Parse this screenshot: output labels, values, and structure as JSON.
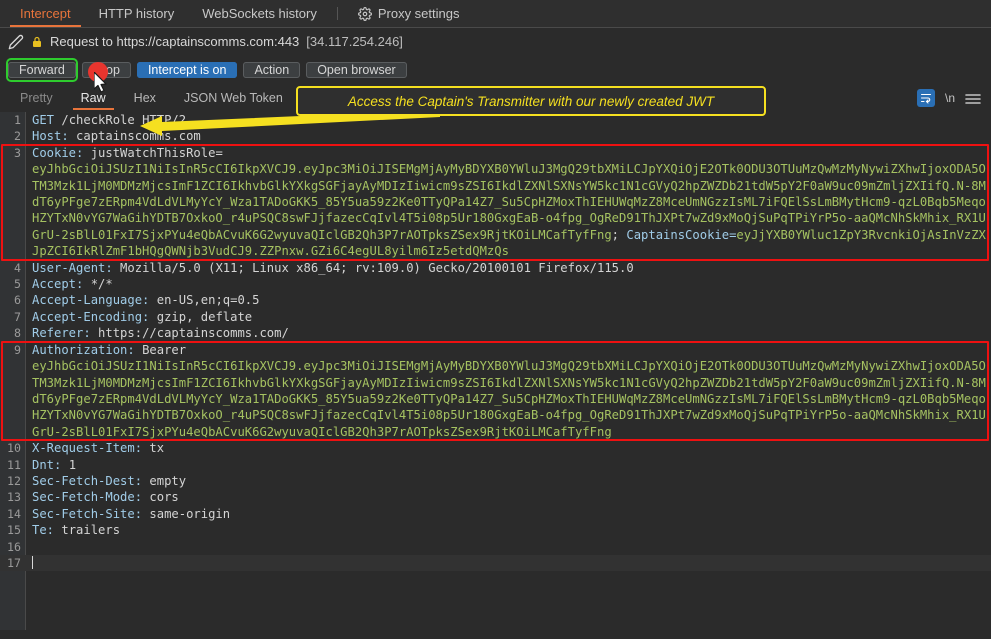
{
  "window": {
    "top_tabs": [
      {
        "label": "Intercept",
        "active": true
      },
      {
        "label": "HTTP history",
        "active": false
      },
      {
        "label": "WebSockets history",
        "active": false
      },
      {
        "label": "Proxy settings",
        "active": false,
        "icon": "gear-icon"
      }
    ]
  },
  "urlbar": {
    "pencil_icon": "pencil-icon",
    "lock_icon": "lock-icon",
    "text": "Request to https://captainscomms.com:443",
    "ip": "[34.117.254.246]"
  },
  "buttons": [
    {
      "label": "Forward",
      "style": "default",
      "focused": true
    },
    {
      "label": "Drop",
      "style": "default",
      "focused": false
    },
    {
      "label": "Intercept is on",
      "style": "primary",
      "focused": false
    },
    {
      "label": "Action",
      "style": "default",
      "focused": false
    },
    {
      "label": "Open browser",
      "style": "default",
      "focused": false
    }
  ],
  "editor_tabs": [
    {
      "label": "Pretty",
      "state": "dim"
    },
    {
      "label": "Raw",
      "state": "active"
    },
    {
      "label": "Hex",
      "state": "normal"
    },
    {
      "label": "JSON Web Token",
      "state": "normal"
    }
  ],
  "editor_tools": {
    "wrap_icon": "word-wrap-icon",
    "newline_label": "\\n",
    "menu_icon": "hamburger-menu-icon"
  },
  "annotation": {
    "text": "Access the Captain's Transmitter with our newly created JWT",
    "border_color": "#f5e020",
    "text_color": "#f5e020",
    "arrow_color": "#f5e020"
  },
  "highlight_color": "#ee1111",
  "request": {
    "lines": [
      {
        "num": "1",
        "kind": "request-line",
        "method": "GET",
        "path": " /checkRole",
        "rest": " HTTP/2"
      },
      {
        "num": "2",
        "kind": "header",
        "name": "Host:",
        "value": " captainscomms.com"
      },
      {
        "num": "3",
        "kind": "header-jwt",
        "name": "Cookie:",
        "value": " justWatchThisRole=",
        "jwt": "eyJhbGciOiJSUzI1NiIsInR5cCI6IkpXVCJ9.eyJpc3MiOiJISEMgMjAyMyBDYXB0YWluJ3MgQ29tbXMiLCJpYXQiOjE2OTk0ODU3OTUuMzQwMzMyNywiZXhwIjoxODA5OTM3Mzk1LjM0MDMzMjcsImF1ZCI6IkhvbGlkYXkgSGFjayAyMDIzIiwicm9sZSI6IkdlZXNlSXNsYW5kc1N1cGVyQ2hpZWZDb21tdW5pY2F0aW9uc09mZmljZXIifQ.N-8MdT6yPFge7zERpm4VdLdVLMyYcY_Wza1TADoGKK5_85Y5ua59z2Ke0TTyQPa14Z7_Su5CpHZMoxThIEHUWqMzZ8MceUmNGzzIsML7iFQElSsLmBMytHcm9-qzL0Bqb5MeqoHZYTxN0vYG7WaGihYDTB7OxkoO_r4uPSQC8swFJjfazecCqIvl4T5i08p5Ur180GxgEaB-o4fpg_OgReD91ThJXPt7wZd9xMoQjSuPqTPiYrP5o-aaQMcNhSkMhix_RX1UGrU-2sBlL01FxI7SjxPYu4eQbACvuK6G2wyuvaQIclGB2Qh3P7rAOTpksZSex9RjtKOiLMCafTyfFng",
        "trailing": "; ",
        "trailing_name": "CaptainsCookie=",
        "trailing_jwt": "eyJjYXB0YWluc1ZpY3RvcnkiOjAsInVzZXJpZCI6IkRlZmF1bHQgQWNjb3VudCJ9.ZZPnxw.GZi6C4egUL8yilm6Iz5etdQMzQs"
      },
      {
        "num": "4",
        "kind": "header",
        "name": "User-Agent:",
        "value": " Mozilla/5.0 (X11; Linux x86_64; rv:109.0) Gecko/20100101 Firefox/115.0"
      },
      {
        "num": "5",
        "kind": "header",
        "name": "Accept:",
        "value": " */*"
      },
      {
        "num": "6",
        "kind": "header",
        "name": "Accept-Language:",
        "value": " en-US,en;q=0.5"
      },
      {
        "num": "7",
        "kind": "header",
        "name": "Accept-Encoding:",
        "value": " gzip, deflate"
      },
      {
        "num": "8",
        "kind": "header",
        "name": "Referer:",
        "value": " https://captainscomms.com/"
      },
      {
        "num": "9",
        "kind": "header-jwt",
        "name": "Authorization:",
        "value": " Bearer",
        "jwt": "eyJhbGciOiJSUzI1NiIsInR5cCI6IkpXVCJ9.eyJpc3MiOiJISEMgMjAyMyBDYXB0YWluJ3MgQ29tbXMiLCJpYXQiOjE2OTk0ODU3OTUuMzQwMzMyNywiZXhwIjoxODA5OTM3Mzk1LjM0MDMzMjcsImF1ZCI6IkhvbGlkYXkgSGFjayAyMDIzIiwicm9sZSI6IkdlZXNlSXNsYW5kc1N1cGVyQ2hpZWZDb21tdW5pY2F0aW9uc09mZmljZXIifQ.N-8MdT6yPFge7zERpm4VdLdVLMyYcY_Wza1TADoGKK5_85Y5ua59z2Ke0TTyQPa14Z7_Su5CpHZMoxThIEHUWqMzZ8MceUmNGzzIsML7iFQElSsLmBMytHcm9-qzL0Bqb5MeqoHZYTxN0vYG7WaGihYDTB7OxkoO_r4uPSQC8swFJjfazecCqIvl4T5i08p5Ur180GxgEaB-o4fpg_OgReD91ThJXPt7wZd9xMoQjSuPqTPiYrP5o-aaQMcNhSkMhix_RX1UGrU-2sBlL01FxI7SjxPYu4eQbACvuK6G2wyuvaQIclGB2Qh3P7rAOTpksZSex9RjtKOiLMCafTyfFng",
        "trailing": "",
        "trailing_name": "",
        "trailing_jwt": ""
      },
      {
        "num": "10",
        "kind": "header",
        "name": "X-Request-Item:",
        "value": " tx"
      },
      {
        "num": "11",
        "kind": "header",
        "name": "Dnt:",
        "value": " 1"
      },
      {
        "num": "12",
        "kind": "header",
        "name": "Sec-Fetch-Dest:",
        "value": " empty"
      },
      {
        "num": "13",
        "kind": "header",
        "name": "Sec-Fetch-Mode:",
        "value": " cors"
      },
      {
        "num": "14",
        "kind": "header",
        "name": "Sec-Fetch-Site:",
        "value": " same-origin"
      },
      {
        "num": "15",
        "kind": "header",
        "name": "Te:",
        "value": " trailers"
      },
      {
        "num": "16",
        "kind": "blank",
        "name": "",
        "value": ""
      },
      {
        "num": "17",
        "kind": "cursor",
        "name": "",
        "value": ""
      }
    ]
  }
}
